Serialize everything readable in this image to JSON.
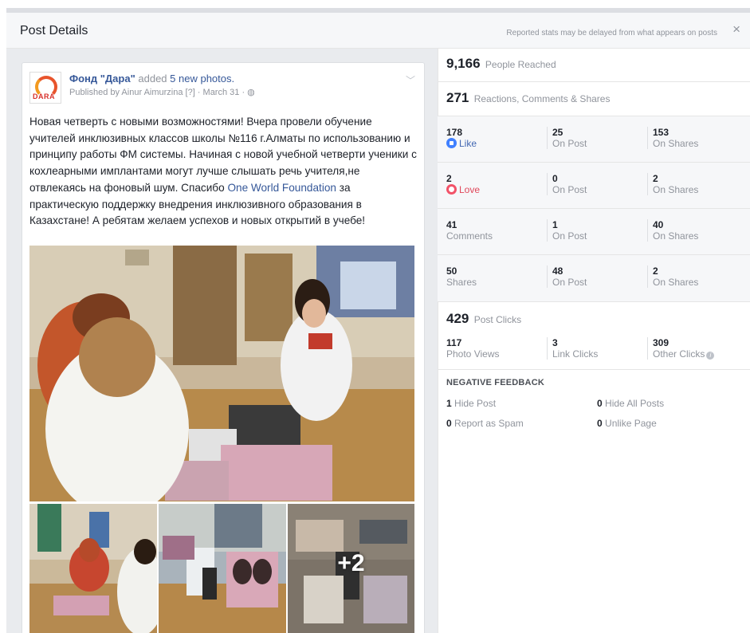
{
  "header": {
    "title": "Post Details",
    "note": "Reported stats may be delayed from what appears on posts",
    "close_glyph": "×"
  },
  "post": {
    "avatar_text": "DARA",
    "page_name": "Фонд \"Дара\"",
    "verb": "added",
    "photos_link": "5 new photos.",
    "published_line": "Published by Ainur Aimurzina [?] · March 31 · ",
    "text_before_link": "Новая четверть с новыми возможностями! Вчера провели обучение учителей инклюзивных классов школы №116 г.Алматы по использованию и принципу работы ФМ системы. Начиная с новой учебной четверти ученики с кохлеарными имплантами могут лучше слышать речь учителя,не отвлекаясь на фоновый шум. Спасибо ",
    "link_text": "One World Foundation",
    "text_after_link": " за практическую поддержку внедрения инклюзивного образования в Казахстане! А ребятам желаем успехов и новых открытий в учебе!",
    "more_photos": "+2"
  },
  "stats": {
    "reach_value": "9,166",
    "reach_label": "People Reached",
    "reactions_value": "271",
    "reactions_label": "Reactions, Comments & Shares",
    "rows": [
      {
        "total": "178",
        "label": "Like",
        "on_post": "25",
        "on_post_label": "On Post",
        "on_shares": "153",
        "on_shares_label": "On Shares"
      },
      {
        "total": "2",
        "label": "Love",
        "on_post": "0",
        "on_post_label": "On Post",
        "on_shares": "2",
        "on_shares_label": "On Shares"
      },
      {
        "total": "41",
        "label": "Comments",
        "on_post": "1",
        "on_post_label": "On Post",
        "on_shares": "40",
        "on_shares_label": "On Shares"
      },
      {
        "total": "50",
        "label": "Shares",
        "on_post": "48",
        "on_post_label": "On Post",
        "on_shares": "2",
        "on_shares_label": "On Shares"
      }
    ],
    "clicks_value": "429",
    "clicks_label": "Post Clicks",
    "clicks": [
      {
        "value": "117",
        "label": "Photo Views"
      },
      {
        "value": "3",
        "label": "Link Clicks"
      },
      {
        "value": "309",
        "label": "Other Clicks"
      }
    ],
    "negative_title": "NEGATIVE FEEDBACK",
    "negative": [
      {
        "value": "1",
        "label": "Hide Post"
      },
      {
        "value": "0",
        "label": "Hide All Posts"
      },
      {
        "value": "0",
        "label": "Report as Spam"
      },
      {
        "value": "0",
        "label": "Unlike Page"
      }
    ]
  },
  "colors": {
    "link": "#365899",
    "muted": "#90949c",
    "like": "#4080ff",
    "love": "#f25268"
  }
}
